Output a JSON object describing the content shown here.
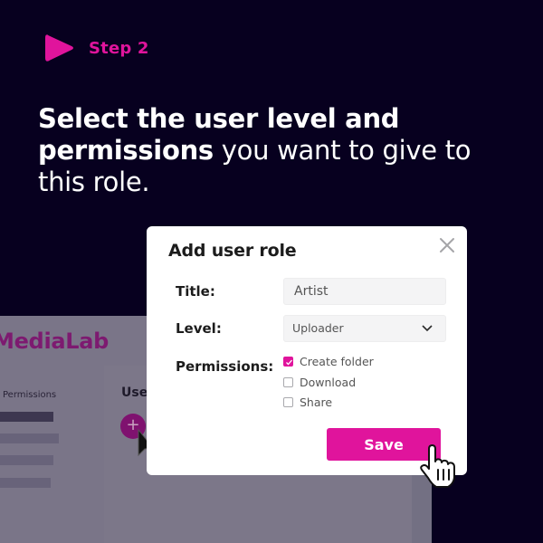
{
  "step": {
    "label": "Step 2",
    "icon": "play-triangle-icon",
    "accent_color": "#e0149c"
  },
  "headline": {
    "bold_part": "Select the user level and permissions",
    "regular_part": " you want to give to this role."
  },
  "background_app": {
    "logo": "MediaLab",
    "sidebar_label": "Permissions",
    "main_title": "Users",
    "add_button_icon": "plus-icon"
  },
  "modal": {
    "title": "Add user role",
    "close_icon": "close-icon",
    "fields": {
      "title": {
        "label": "Title:",
        "value": "Artist"
      },
      "level": {
        "label": "Level:",
        "value": "Uploader"
      },
      "permissions": {
        "label": "Permissions:",
        "options": [
          {
            "label": "Create folder",
            "checked": true
          },
          {
            "label": "Download",
            "checked": false
          },
          {
            "label": "Share",
            "checked": false
          }
        ]
      }
    },
    "save_label": "Save"
  },
  "colors": {
    "background": "#07001f",
    "accent": "#e0149c",
    "app_logo": "#7d1a70"
  }
}
